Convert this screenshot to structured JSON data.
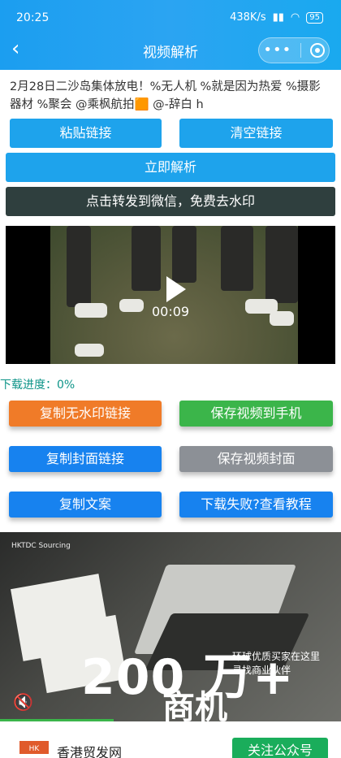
{
  "status": {
    "time": "20:25",
    "speed": "438K/s",
    "battery": "95"
  },
  "nav": {
    "title": "视频解析"
  },
  "link_text": "2月28日二沙岛集体放电！%无人机 %就是因为热爱 %摄影器材 %聚会 @乘枫航拍🟧 @-辞白 h",
  "buttons": {
    "paste": "粘贴链接",
    "clear": "清空链接",
    "parse": "立即解析",
    "share": "点击转发到微信，免费去水印",
    "copy_nowm": "复制无水印链接",
    "save_video": "保存视频到手机",
    "copy_cover": "复制封面链接",
    "save_cover": "保存视频封面",
    "copy_text": "复制文案",
    "tutorial": "下载失败?查看教程"
  },
  "video": {
    "time": "00:09"
  },
  "progress": {
    "label": "下载进度：0%"
  },
  "ad": {
    "logo_text": "HKTDC Sourcing",
    "big": "200 万+",
    "big2": "商机",
    "small_line1": "环球优质买家在这里",
    "small_line2": "寻找商业伙伴"
  },
  "footer": {
    "name": "香港贸发网",
    "follow": "关注公众号"
  },
  "colors": {
    "header": "#1ea3ec",
    "orange": "#f07b28",
    "green": "#3bb54a",
    "blue": "#1782ef",
    "gray": "#8c9096",
    "dark": "#2f3f3e",
    "progress": "#0d9488"
  },
  "icons": {
    "back": "chevron-left-icon",
    "more": "more-dots-icon",
    "close": "target-icon",
    "play": "play-icon",
    "mute": "mute-icon"
  }
}
